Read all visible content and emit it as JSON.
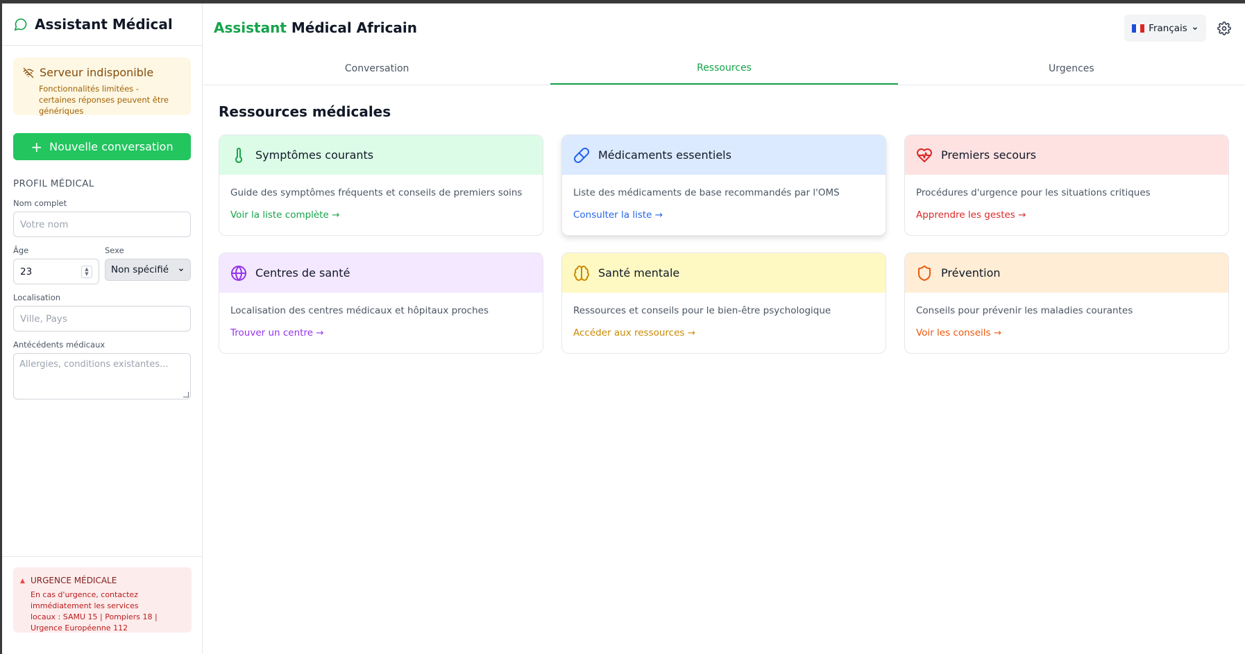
{
  "sidebar": {
    "brand": "Assistant Médical",
    "server_warning": {
      "title": "Serveur indisponible",
      "text": "Fonctionnalités limitées - certaines réponses peuvent être génériques"
    },
    "new_conversation": "Nouvelle conversation",
    "profile_title": "PROFIL MÉDICAL",
    "name_label": "Nom complet",
    "name_placeholder": "Votre nom",
    "age_label": "Âge",
    "age_value": "23",
    "sex_label": "Sexe",
    "sex_value": "Non spécifié",
    "location_label": "Localisation",
    "location_placeholder": "Ville, Pays",
    "history_label": "Antécédents médicaux",
    "history_placeholder": "Allergies, conditions existantes...",
    "emergency": {
      "title": "URGENCE MÉDICALE",
      "text": "En cas d'urgence, contactez immédiatement les services locaux : SAMU 15 | Pompiers 18 | Urgence Européenne 112"
    }
  },
  "header": {
    "title_accent": "Assistant",
    "title_rest": " Médical Africain",
    "language": "Français"
  },
  "tabs": [
    {
      "label": "Conversation",
      "active": false
    },
    {
      "label": "Ressources",
      "active": true
    },
    {
      "label": "Urgences",
      "active": false
    }
  ],
  "main": {
    "title": "Ressources médicales",
    "cards": [
      {
        "title": "Symptômes courants",
        "desc": "Guide des symptômes fréquents et conseils de premiers soins",
        "link": "Voir la liste complète →",
        "icon": "thermometer-icon",
        "bg": "#dcfce7",
        "color": "#16a34a"
      },
      {
        "title": "Médicaments essentiels",
        "desc": "Liste des médicaments de base recommandés par l'OMS",
        "link": "Consulter la liste →",
        "icon": "pill-icon",
        "bg": "#dbeafe",
        "color": "#2563eb"
      },
      {
        "title": "Premiers secours",
        "desc": "Procédures d'urgence pour les situations critiques",
        "link": "Apprendre les gestes →",
        "icon": "heart-pulse-icon",
        "bg": "#fee2e2",
        "color": "#dc2626"
      },
      {
        "title": "Centres de santé",
        "desc": "Localisation des centres médicaux et hôpitaux proches",
        "link": "Trouver un centre →",
        "icon": "globe-icon",
        "bg": "#f3e8ff",
        "color": "#9333ea"
      },
      {
        "title": "Santé mentale",
        "desc": "Ressources et conseils pour le bien-être psychologique",
        "link": "Accéder aux ressources →",
        "icon": "brain-icon",
        "bg": "#fef9c3",
        "color": "#ca8a04"
      },
      {
        "title": "Prévention",
        "desc": "Conseils pour prévenir les maladies courantes",
        "link": "Voir les conseils →",
        "icon": "shield-icon",
        "bg": "#ffedd5",
        "color": "#ea580c"
      }
    ]
  }
}
